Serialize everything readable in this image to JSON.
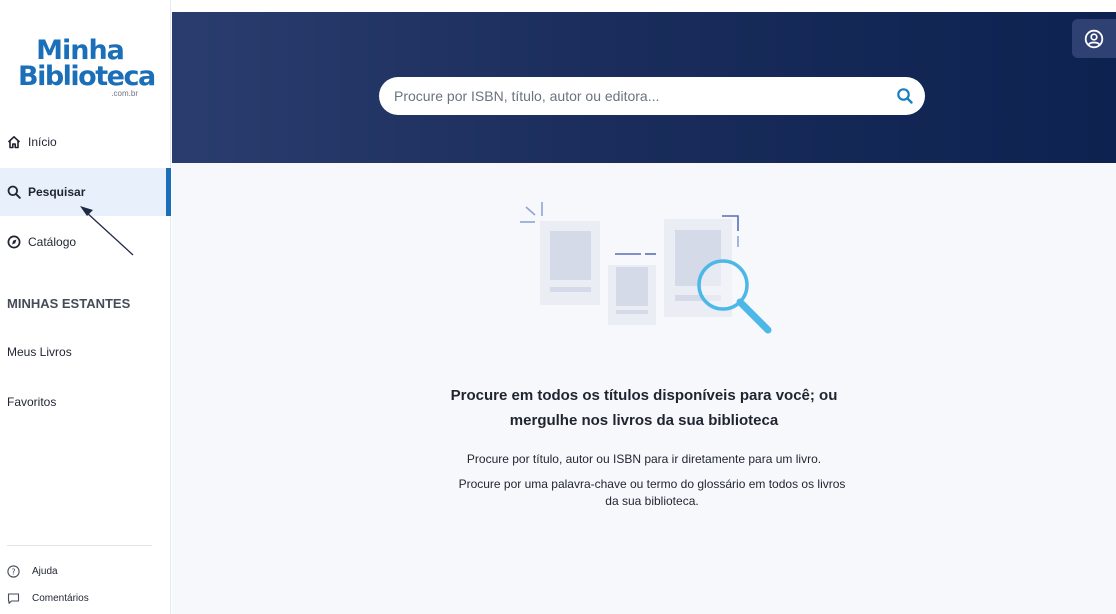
{
  "app": {
    "logo": {
      "line1": "Minha",
      "line2": "Biblioteca",
      "line3": ".com.br"
    }
  },
  "sidebar": {
    "nav": [
      {
        "label": "Início",
        "icon": "home-icon"
      },
      {
        "label": "Pesquisar",
        "icon": "search-icon",
        "active": true
      },
      {
        "label": "Catálogo",
        "icon": "catalog-icon"
      }
    ],
    "section_title": "MINHAS ESTANTES",
    "shelves": [
      {
        "label": "Meus Livros"
      },
      {
        "label": "Favoritos"
      }
    ],
    "footer": [
      {
        "label": "Ajuda",
        "icon": "help-icon"
      },
      {
        "label": "Comentários",
        "icon": "comment-icon"
      }
    ]
  },
  "header": {
    "search_placeholder": "Procure por ISBN, título, autor ou editora...",
    "search_value": ""
  },
  "main": {
    "headline_line1": "Procure em todos os títulos disponíveis para você; ou",
    "headline_line2": "mergulhe nos livros da sua biblioteca",
    "desc1": "Procure por título, autor ou ISBN para ir diretamente para um livro.",
    "desc2": "Procure por uma palavra-chave ou termo do glossário em todos os livros da sua biblioteca."
  },
  "colors": {
    "brand": "#1a6fb8",
    "header_dark": "#0d2250",
    "search_accent": "#1a7fc1",
    "illustration_blue": "#4db8e8"
  }
}
